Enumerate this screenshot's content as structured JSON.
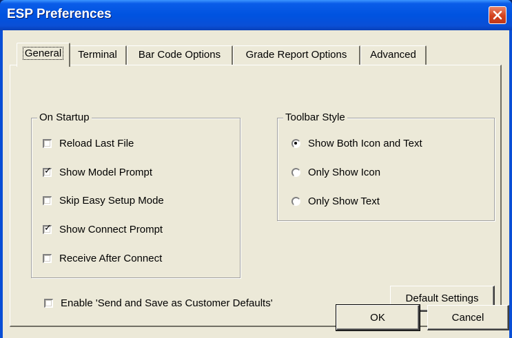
{
  "window": {
    "title": "ESP Preferences"
  },
  "tabs": [
    {
      "label": "General",
      "active": true
    },
    {
      "label": "Terminal",
      "active": false
    },
    {
      "label": "Bar Code Options",
      "active": false
    },
    {
      "label": "Grade Report Options",
      "active": false
    },
    {
      "label": "Advanced",
      "active": false
    }
  ],
  "on_startup": {
    "label": "On Startup",
    "options": [
      {
        "label": "Reload Last File",
        "checked": false
      },
      {
        "label": "Show Model Prompt",
        "checked": true
      },
      {
        "label": "Skip Easy Setup Mode",
        "checked": false
      },
      {
        "label": "Show Connect Prompt",
        "checked": true
      },
      {
        "label": "Receive After Connect",
        "checked": false
      }
    ]
  },
  "toolbar_style": {
    "label": "Toolbar Style",
    "options": [
      {
        "label": "Show Both Icon and Text",
        "selected": true
      },
      {
        "label": "Only Show Icon",
        "selected": false
      },
      {
        "label": "Only Show Text",
        "selected": false
      }
    ]
  },
  "customer_defaults": {
    "label": "Enable 'Send and Save as Customer Defaults'",
    "checked": false
  },
  "buttons": {
    "default_settings": "Default Settings",
    "ok": "OK",
    "cancel": "Cancel"
  },
  "icons": {
    "close": "close-icon"
  },
  "colors": {
    "title_bar": "#0053e0",
    "client_bg": "#ece9d8",
    "close_button": "#d3411c"
  }
}
